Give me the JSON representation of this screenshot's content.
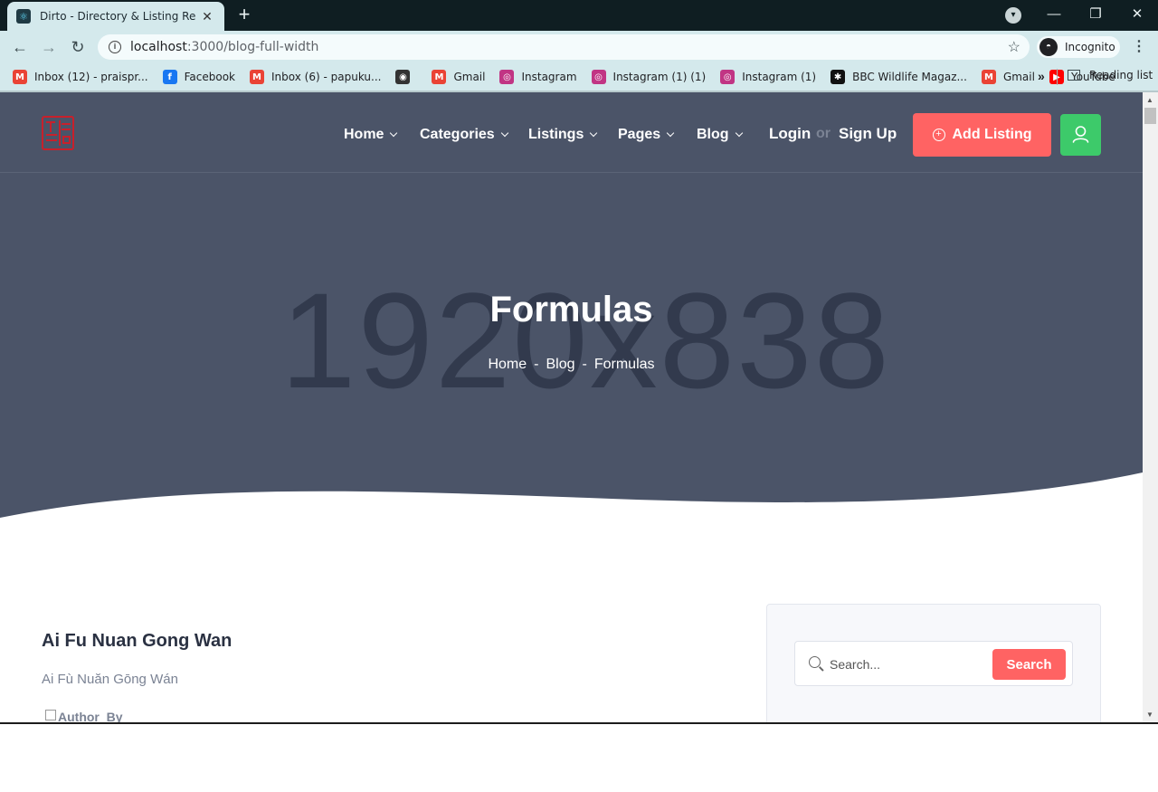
{
  "browser": {
    "tab_title": "Dirto - Directory & Listing React",
    "tab_close": "✕",
    "new_tab": "+",
    "url_host": "localhost",
    "url_rest": ":3000/blog-full-width",
    "incognito_label": "Incognito",
    "bookmarks": [
      {
        "label": "Inbox (12) - praispr...",
        "icon": "gmail-icon",
        "color": "#ea4335",
        "glyph": "M"
      },
      {
        "label": "Facebook",
        "icon": "facebook-icon",
        "color": "#1877f2",
        "glyph": "f"
      },
      {
        "label": "Inbox (6) - papuku...",
        "icon": "gmail-icon",
        "color": "#ea4335",
        "glyph": "M"
      },
      {
        "label": "",
        "icon": "globe-icon",
        "color": "#333333",
        "glyph": "◉"
      },
      {
        "label": "Gmail",
        "icon": "gmail-icon",
        "color": "#ea4335",
        "glyph": "M"
      },
      {
        "label": "Instagram",
        "icon": "instagram-icon",
        "color": "#c13584",
        "glyph": "◎"
      },
      {
        "label": "Instagram (1) (1)",
        "icon": "instagram-icon",
        "color": "#c13584",
        "glyph": "◎"
      },
      {
        "label": "Instagram (1)",
        "icon": "instagram-icon",
        "color": "#c13584",
        "glyph": "◎"
      },
      {
        "label": "BBC Wildlife Magaz...",
        "icon": "paw-icon",
        "color": "#111111",
        "glyph": "✱"
      },
      {
        "label": "Gmail",
        "icon": "gmail-icon",
        "color": "#ea4335",
        "glyph": "M"
      },
      {
        "label": "YouTube",
        "icon": "youtube-icon",
        "color": "#ff0000",
        "glyph": "▶"
      }
    ],
    "bookmarks_more": "»",
    "reading_list": "Reading list"
  },
  "header": {
    "nav": [
      {
        "label": "Home"
      },
      {
        "label": "Categories"
      },
      {
        "label": "Listings"
      },
      {
        "label": "Pages"
      },
      {
        "label": "Blog"
      }
    ],
    "login": "Login",
    "or": "or",
    "signup": "Sign Up",
    "add_listing": "Add Listing"
  },
  "hero": {
    "placeholder": "1920x838",
    "title": "Formulas",
    "breadcrumbs": [
      "Home",
      "Blog",
      "Formulas"
    ],
    "separator": "-"
  },
  "post": {
    "title": "Ai Fu Nuan Gong Wan",
    "subtitle": "Ai Fù Nuăn Gōng Wán",
    "author_alt": "Author",
    "by": "By"
  },
  "sidebar": {
    "search_placeholder": "Search...",
    "search_button": "Search"
  },
  "colors": {
    "hero_bg": "#4b5468",
    "accent": "#ff6363",
    "user_button": "#3dca6a"
  }
}
